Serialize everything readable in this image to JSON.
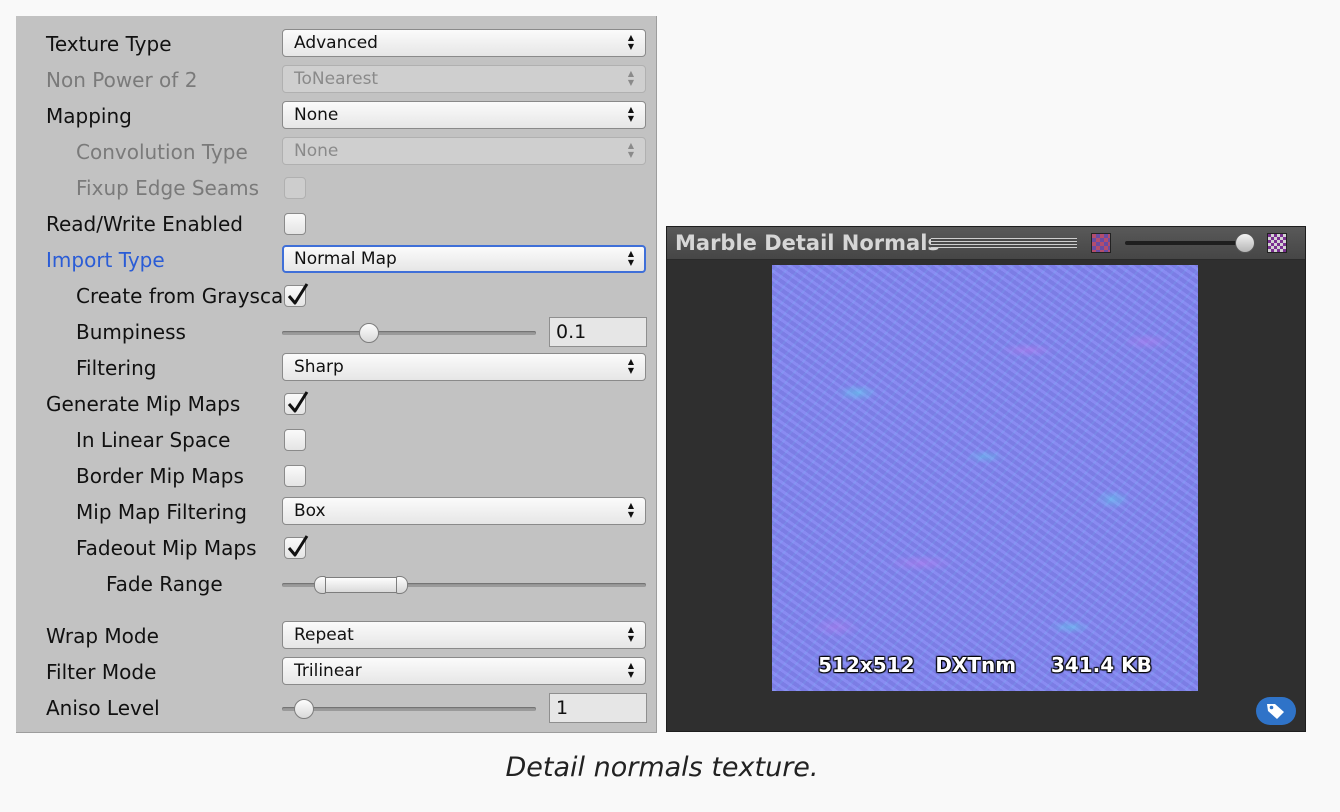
{
  "inspector": {
    "texture_type": {
      "label": "Texture Type",
      "value": "Advanced"
    },
    "non_power_of_2": {
      "label": "Non Power of 2",
      "value": "ToNearest"
    },
    "mapping": {
      "label": "Mapping",
      "value": "None"
    },
    "convolution_type": {
      "label": "Convolution Type",
      "value": "None"
    },
    "fixup_edge_seams": {
      "label": "Fixup Edge Seams",
      "checked": false
    },
    "read_write": {
      "label": "Read/Write Enabled",
      "checked": false
    },
    "import_type": {
      "label": "Import Type",
      "value": "Normal Map"
    },
    "create_from_grayscale": {
      "label": "Create from Grayscale",
      "checked": true
    },
    "bumpiness": {
      "label": "Bumpiness",
      "value": "0.1",
      "slider_fraction": 0.3
    },
    "filtering": {
      "label": "Filtering",
      "value": "Sharp"
    },
    "generate_mip_maps": {
      "label": "Generate Mip Maps",
      "checked": true
    },
    "in_linear_space": {
      "label": "In Linear Space",
      "checked": false
    },
    "border_mip_maps": {
      "label": "Border Mip Maps",
      "checked": false
    },
    "mip_map_filtering": {
      "label": "Mip Map Filtering",
      "value": "Box"
    },
    "fadeout_mip_maps": {
      "label": "Fadeout Mip Maps",
      "checked": true
    },
    "fade_range": {
      "label": "Fade Range",
      "range": [
        0.1,
        0.33
      ]
    },
    "wrap_mode": {
      "label": "Wrap Mode",
      "value": "Repeat"
    },
    "filter_mode": {
      "label": "Filter Mode",
      "value": "Trilinear"
    },
    "aniso_level": {
      "label": "Aniso Level",
      "value": "1",
      "slider_fraction": 0.07
    }
  },
  "preview": {
    "title": "Marble Detail Normals",
    "mip_slider_fraction": 1.0,
    "info": "512x512   DXTnm     341.4 KB",
    "icons": [
      "rgb-checker-icon",
      "alpha-checker-icon",
      "tag-icon"
    ]
  },
  "caption": "Detail normals texture.",
  "colors": {
    "inspector_bg": "#c2c2c2",
    "focus_blue": "#2a5cd6",
    "preview_bg": "#2f2f2f",
    "normal_map_base": "#8087f2",
    "tag_button": "#2f73c8"
  }
}
